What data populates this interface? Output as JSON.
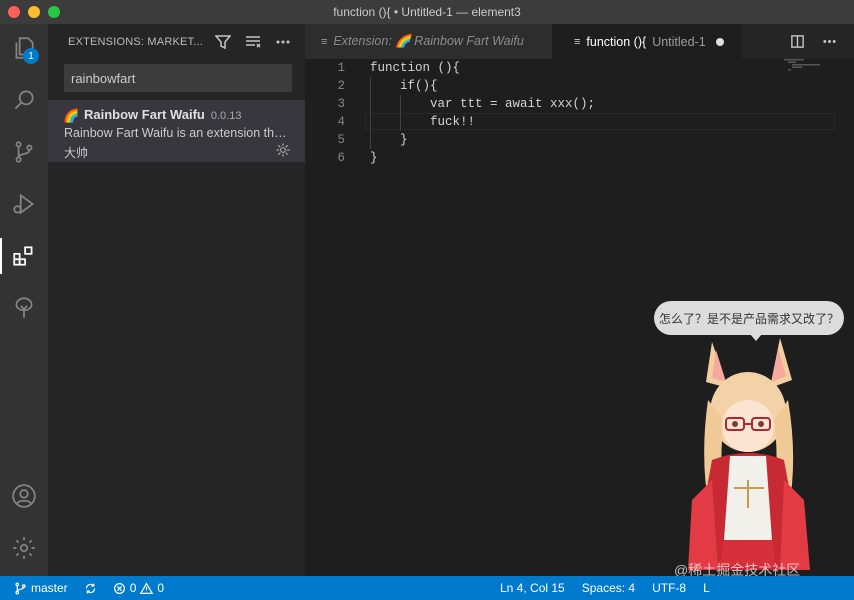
{
  "window": {
    "title": "function (){ • Untitled-1 — element3"
  },
  "activity_bar": {
    "items": [
      {
        "icon": "files-icon",
        "badge": "1"
      },
      {
        "icon": "search-icon"
      },
      {
        "icon": "source-control-icon"
      },
      {
        "icon": "run-debug-icon"
      },
      {
        "icon": "extensions-icon"
      },
      {
        "icon": "tree-icon"
      }
    ],
    "bottom": [
      {
        "icon": "account-icon"
      },
      {
        "icon": "gear-icon"
      }
    ]
  },
  "sidebar": {
    "title": "EXTENSIONS: MARKET...",
    "search_value": "rainbowfart",
    "extension": {
      "logo": "🌈",
      "name": "Rainbow Fart Waifu",
      "version": "0.0.13",
      "description": "Rainbow Fart Waifu is an extension that...",
      "author": "大帅"
    }
  },
  "tabs": [
    {
      "icon": "≡",
      "label": "Extension: 🌈 Rainbow Fart Waifu",
      "active": false
    },
    {
      "icon": "≡",
      "label": "function (){",
      "description": "Untitled-1",
      "dirty": true,
      "active": true
    }
  ],
  "editor": {
    "lines": [
      {
        "num": "1",
        "text": "function (){"
      },
      {
        "num": "2",
        "text": "    if(){"
      },
      {
        "num": "3",
        "text": "        var ttt = await xxx();"
      },
      {
        "num": "4",
        "text": "        fuck!!"
      },
      {
        "num": "5",
        "text": "    }"
      },
      {
        "num": "6",
        "text": "}"
      }
    ]
  },
  "overlay": {
    "speech": "怎么了？是不是产品需求又改了？",
    "watermark": "@稀土掘金技术社区"
  },
  "statusbar": {
    "branch": "master",
    "errors": "0",
    "warnings": "0",
    "position": "Ln 4, Col 15",
    "spaces": "Spaces: 4",
    "encoding": "UTF-8",
    "eol": "L"
  },
  "colors": {
    "accent": "#007acc",
    "editor_bg": "#1e1e1e",
    "sidebar_bg": "#252526"
  }
}
